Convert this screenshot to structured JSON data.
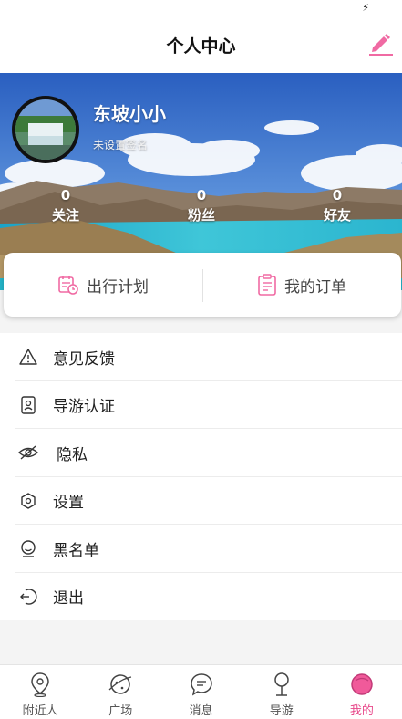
{
  "header": {
    "title": "个人中心"
  },
  "profile": {
    "username": "东坡小小",
    "signature": "未设置签名"
  },
  "stats": [
    {
      "count": "0",
      "label": "关注"
    },
    {
      "count": "0",
      "label": "粉丝"
    },
    {
      "count": "0",
      "label": "好友"
    }
  ],
  "quick_actions": [
    {
      "label": "出行计划",
      "icon": "calendar-clock-icon"
    },
    {
      "label": "我的订单",
      "icon": "clipboard-list-icon"
    }
  ],
  "menu": [
    {
      "label": "意见反馈",
      "icon": "warning-triangle-icon"
    },
    {
      "label": "导游认证",
      "icon": "id-card-icon"
    },
    {
      "label": "隐私",
      "icon": "eye-off-icon"
    },
    {
      "label": "设置",
      "icon": "hexagon-settings-icon"
    },
    {
      "label": "黑名单",
      "icon": "smiley-face-icon"
    },
    {
      "label": "退出",
      "icon": "logout-icon"
    }
  ],
  "tabs": [
    {
      "label": "附近人",
      "icon": "location-pin-icon",
      "active": false
    },
    {
      "label": "广场",
      "icon": "planet-icon",
      "active": false
    },
    {
      "label": "消息",
      "icon": "chat-bubble-icon",
      "active": false
    },
    {
      "label": "导游",
      "icon": "guide-pin-icon",
      "active": false
    },
    {
      "label": "我的",
      "icon": "profile-circle-icon",
      "active": true
    }
  ],
  "colors": {
    "accent": "#e8488a",
    "icon_pink": "#f06aa3"
  }
}
